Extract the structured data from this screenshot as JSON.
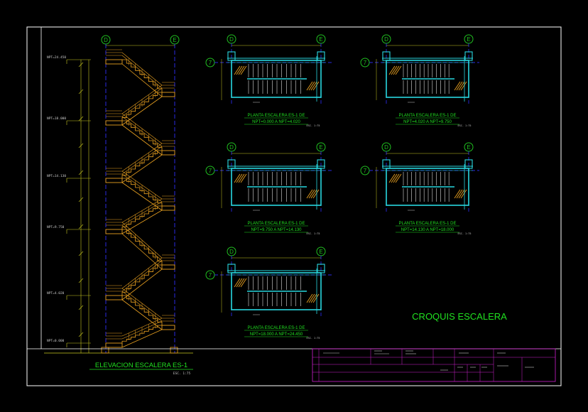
{
  "colors": {
    "background": "#000000",
    "frame": "#ffffff",
    "stair": "#e8a020",
    "structure": "#28d8e0",
    "axis": "#2a2ae0",
    "grid_bubble": "#20c020",
    "title_green": "#20e020",
    "title_block": "#d020d0",
    "dimension": "#c8c820",
    "note": "#e02020"
  },
  "grid": {
    "axis_d": "D",
    "axis_e": "E",
    "axis_7": "7"
  },
  "elevation": {
    "title": "ELEVACION ESCALERA ES-1",
    "scale": "ESC. 1:75",
    "levels": [
      "NPT=24.450",
      "NPT=18.000",
      "NPT=14.130",
      "NPT=9.750",
      "NPT=4.020",
      "NPT=0.000"
    ]
  },
  "plans": [
    {
      "line1": "PLANTA ESCALERA ES-1 DE",
      "line2": "NPT=0.000 A NPT=4.020",
      "scale": "ESC. 1:75"
    },
    {
      "line1": "PLANTA ESCALERA ES-1 DE",
      "line2": "NPT=4.020 A NPT=9.750",
      "scale": "ESC. 1:75"
    },
    {
      "line1": "PLANTA ESCALERA ES-1 DE",
      "line2": "NPT=9.750 A NPT=14.130",
      "scale": "ESC. 1:75"
    },
    {
      "line1": "PLANTA ESCALERA ES-1 DE",
      "line2": "NPT=14.130 A NPT=18.000",
      "scale": "ESC. 1:75"
    },
    {
      "line1": "PLANTA ESCALERA ES-1 DE",
      "line2": "NPT=18.000 A NPT=24.450",
      "scale": "ESC. 1:75"
    }
  ],
  "sheet_title": "CROQUIS ESCALERA"
}
